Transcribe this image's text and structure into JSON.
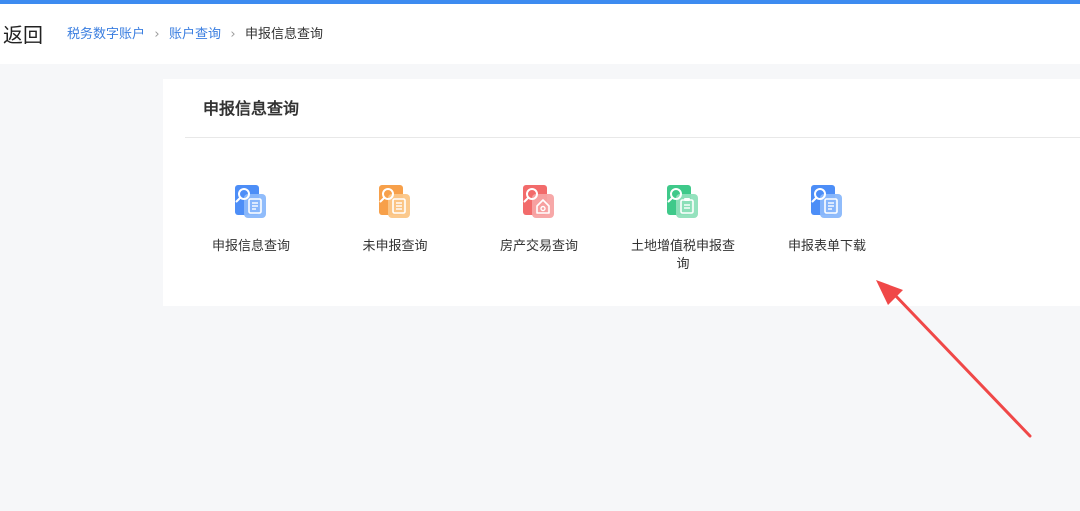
{
  "header": {
    "back_label": "返回",
    "breadcrumb": [
      {
        "label": "税务数字账户",
        "link": true
      },
      {
        "label": "账户查询",
        "link": true
      },
      {
        "label": "申报信息查询",
        "link": false
      }
    ]
  },
  "card": {
    "title": "申报信息查询",
    "tiles": [
      {
        "label": "申报信息查询",
        "icon": "declaration-query-icon",
        "color": "#4d8ef7"
      },
      {
        "label": "未申报查询",
        "icon": "undeclared-query-icon",
        "color": "#f7a04a"
      },
      {
        "label": "房产交易查询",
        "icon": "property-transaction-query-icon",
        "color": "#f26b6b"
      },
      {
        "label": "土地增值税申报查询",
        "icon": "land-vat-declaration-query-icon",
        "color": "#3fc98a"
      },
      {
        "label": "申报表单下载",
        "icon": "form-download-icon",
        "color": "#4d8ef7"
      }
    ]
  },
  "colors": {
    "accent": "#3d8bf0",
    "annotation_arrow": "#f04848"
  }
}
